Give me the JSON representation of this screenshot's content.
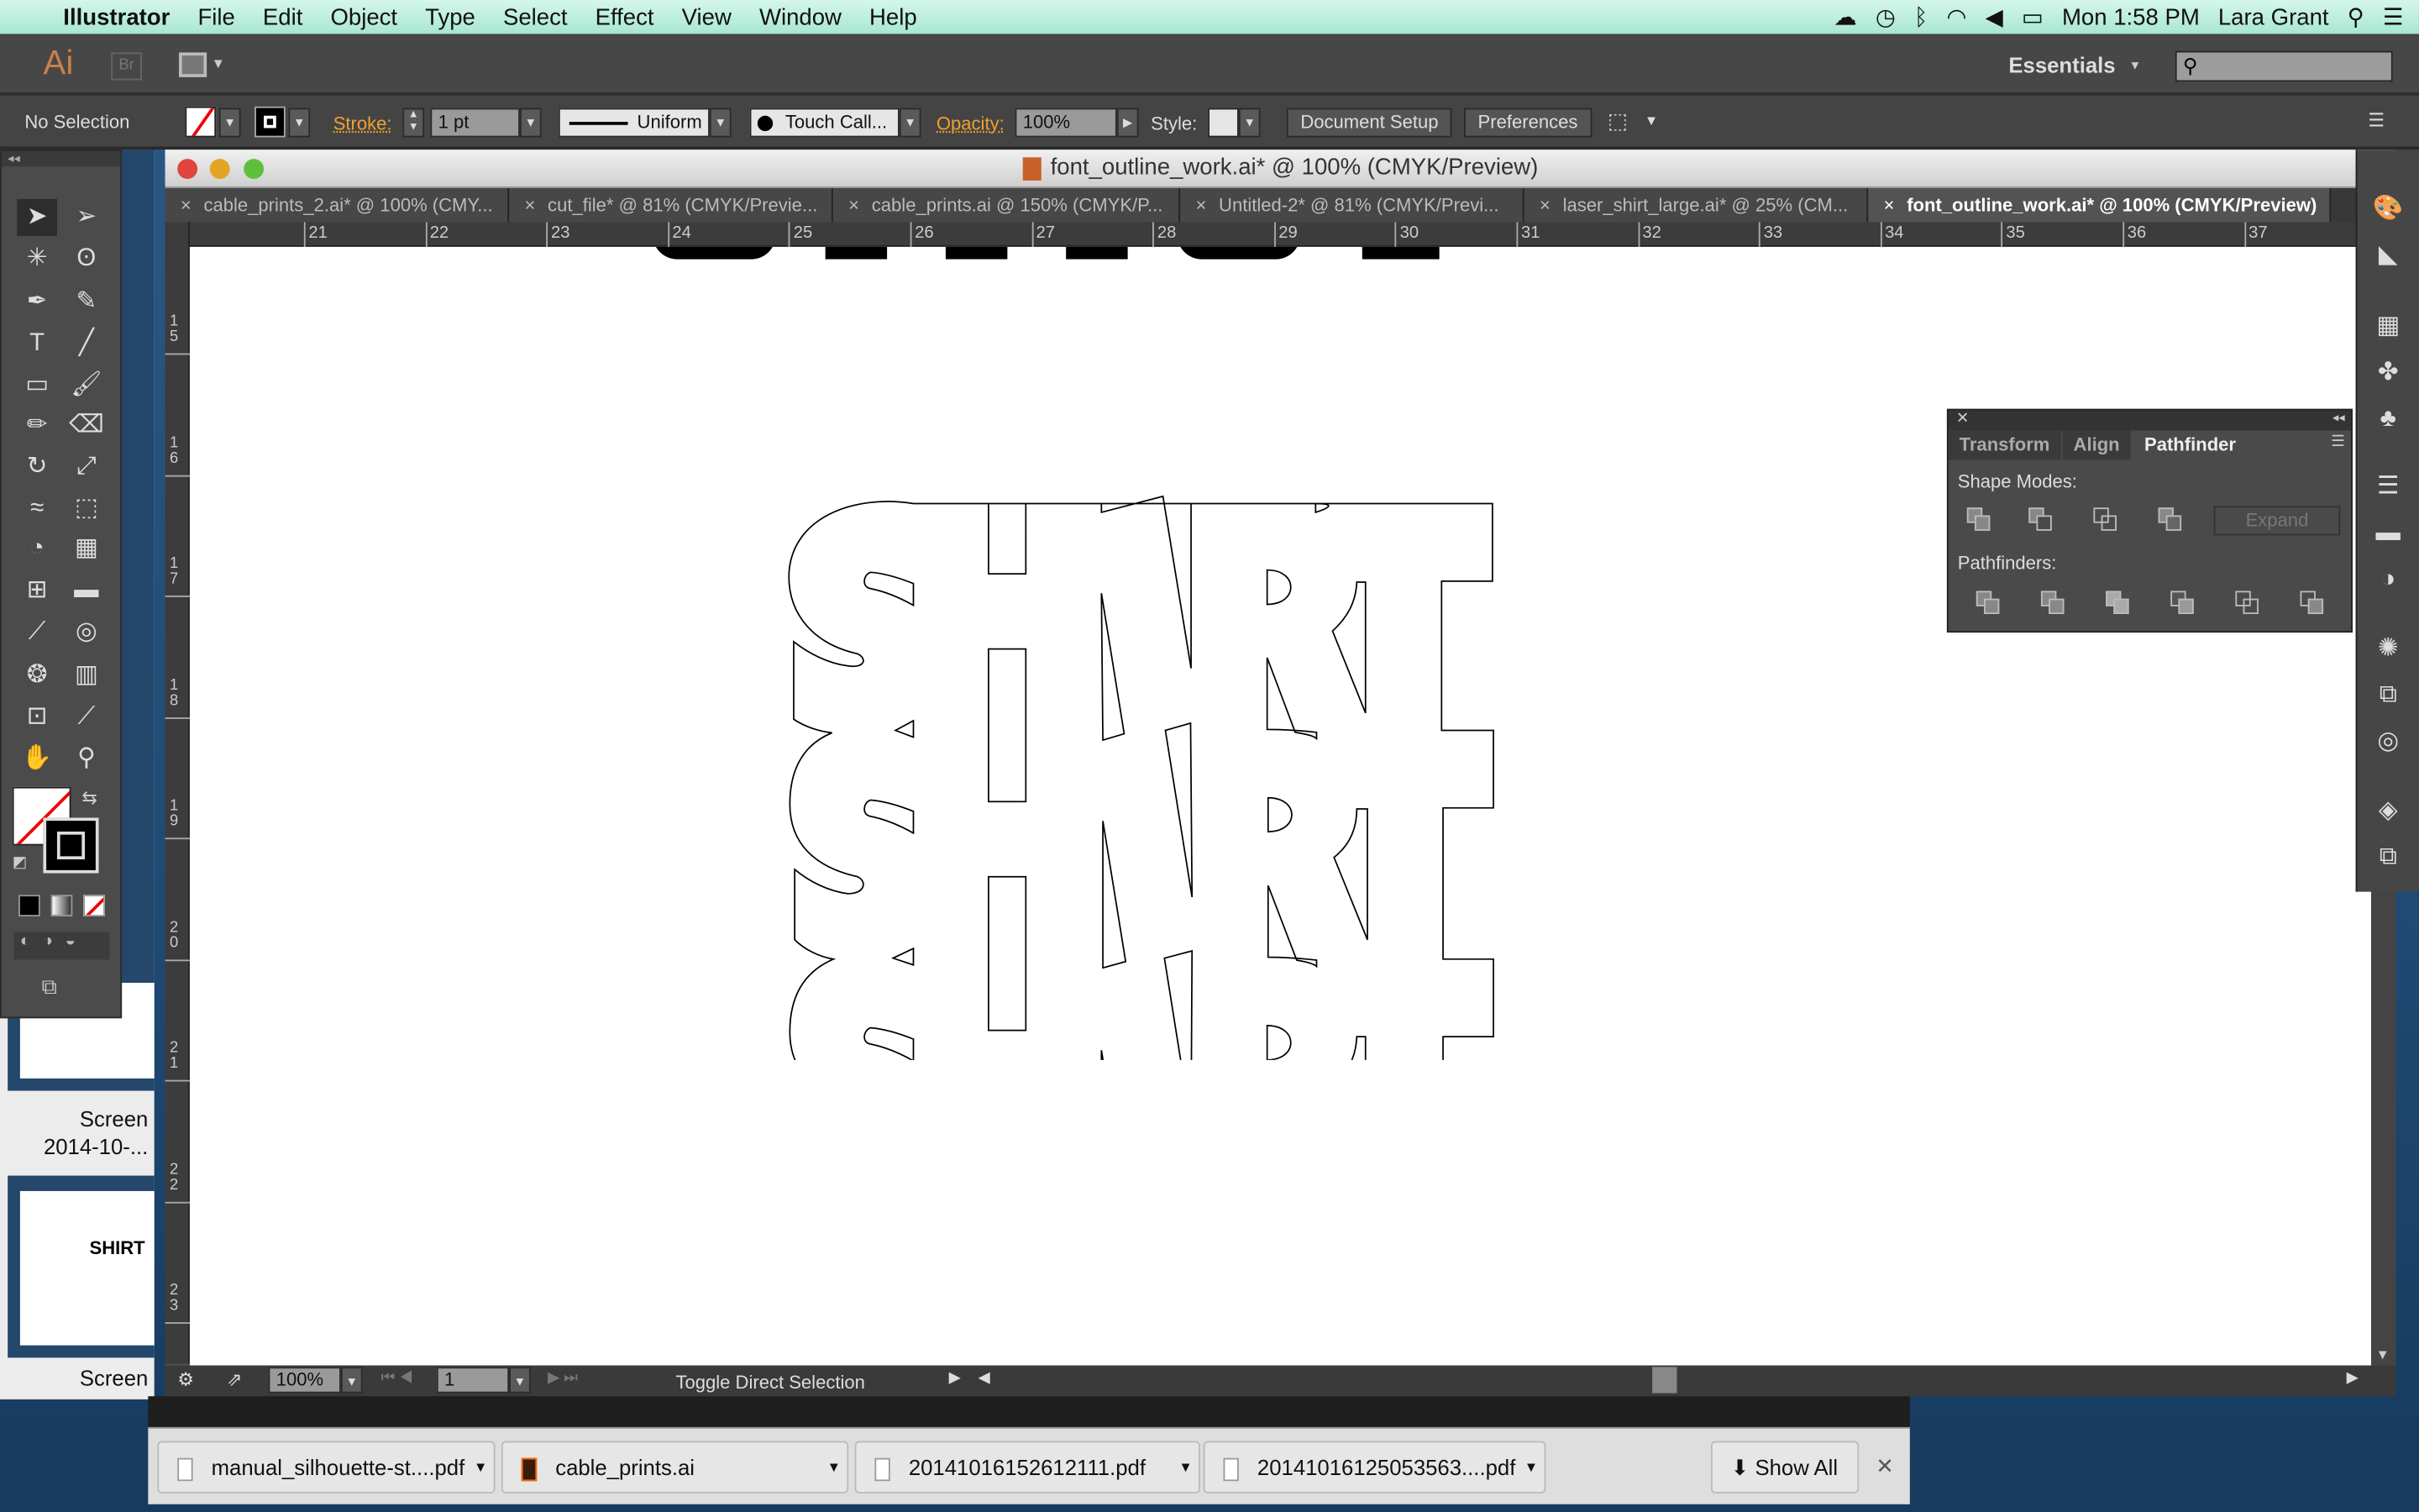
{
  "menubar": {
    "app": "Illustrator",
    "items": [
      "File",
      "Edit",
      "Object",
      "Type",
      "Select",
      "Effect",
      "View",
      "Window",
      "Help"
    ],
    "clock": "Mon 1:58 PM",
    "user": "Lara Grant"
  },
  "appbar": {
    "logo": "Ai",
    "bridge": "Br",
    "workspace": "Essentials",
    "search_placeholder": ""
  },
  "control": {
    "selection": "No Selection",
    "stroke_label": "Stroke:",
    "stroke_weight": "1 pt",
    "profile": "Uniform",
    "brush": "Touch Call...",
    "opacity_label": "Opacity:",
    "opacity": "100%",
    "style_label": "Style:",
    "document_setup": "Document Setup",
    "preferences": "Preferences"
  },
  "document": {
    "title": "font_outline_work.ai* @ 100% (CMYK/Preview)",
    "tabs": [
      "cable_prints_2.ai* @ 100% (CMY...",
      "cut_file* @ 81% (CMYK/Previe...",
      "cable_prints.ai @ 150% (CMYK/P...",
      "Untitled-2* @ 81% (CMYK/Previ...",
      "laser_shirt_large.ai* @ 25% (CM...",
      "font_outline_work.ai* @ 100% (CMYK/Preview)"
    ],
    "active_tab": 5,
    "hruler": [
      "21",
      "22",
      "23",
      "24",
      "25",
      "26",
      "27",
      "28",
      "29",
      "30",
      "31",
      "32",
      "33",
      "34",
      "35",
      "36",
      "37"
    ],
    "vruler": [
      "15",
      "16",
      "17",
      "18",
      "19",
      "20",
      "21",
      "22",
      "23"
    ]
  },
  "statusbar": {
    "zoom": "100%",
    "page": "1",
    "status": "Toggle Direct Selection"
  },
  "pathfinder": {
    "tabs": [
      "Transform",
      "Align",
      "Pathfinder"
    ],
    "active_tab": "Pathfinder",
    "shape_modes": "Shape Modes:",
    "expand": "Expand",
    "pathfinders": "Pathfinders:"
  },
  "finder": {
    "captions": [
      "Screen",
      "2014-10-...",
      "Screen"
    ],
    "thumb_text": "SHIRT"
  },
  "downloads": {
    "items": [
      "manual_silhouette-st....pdf",
      "cable_prints.ai",
      "20141016152612111.pdf",
      "20141016125053563....pdf"
    ],
    "show_all": "Show All"
  },
  "colors": {
    "accent": "#f0a030",
    "menubar": "#b8eddc",
    "panel": "#4a4a4a"
  }
}
